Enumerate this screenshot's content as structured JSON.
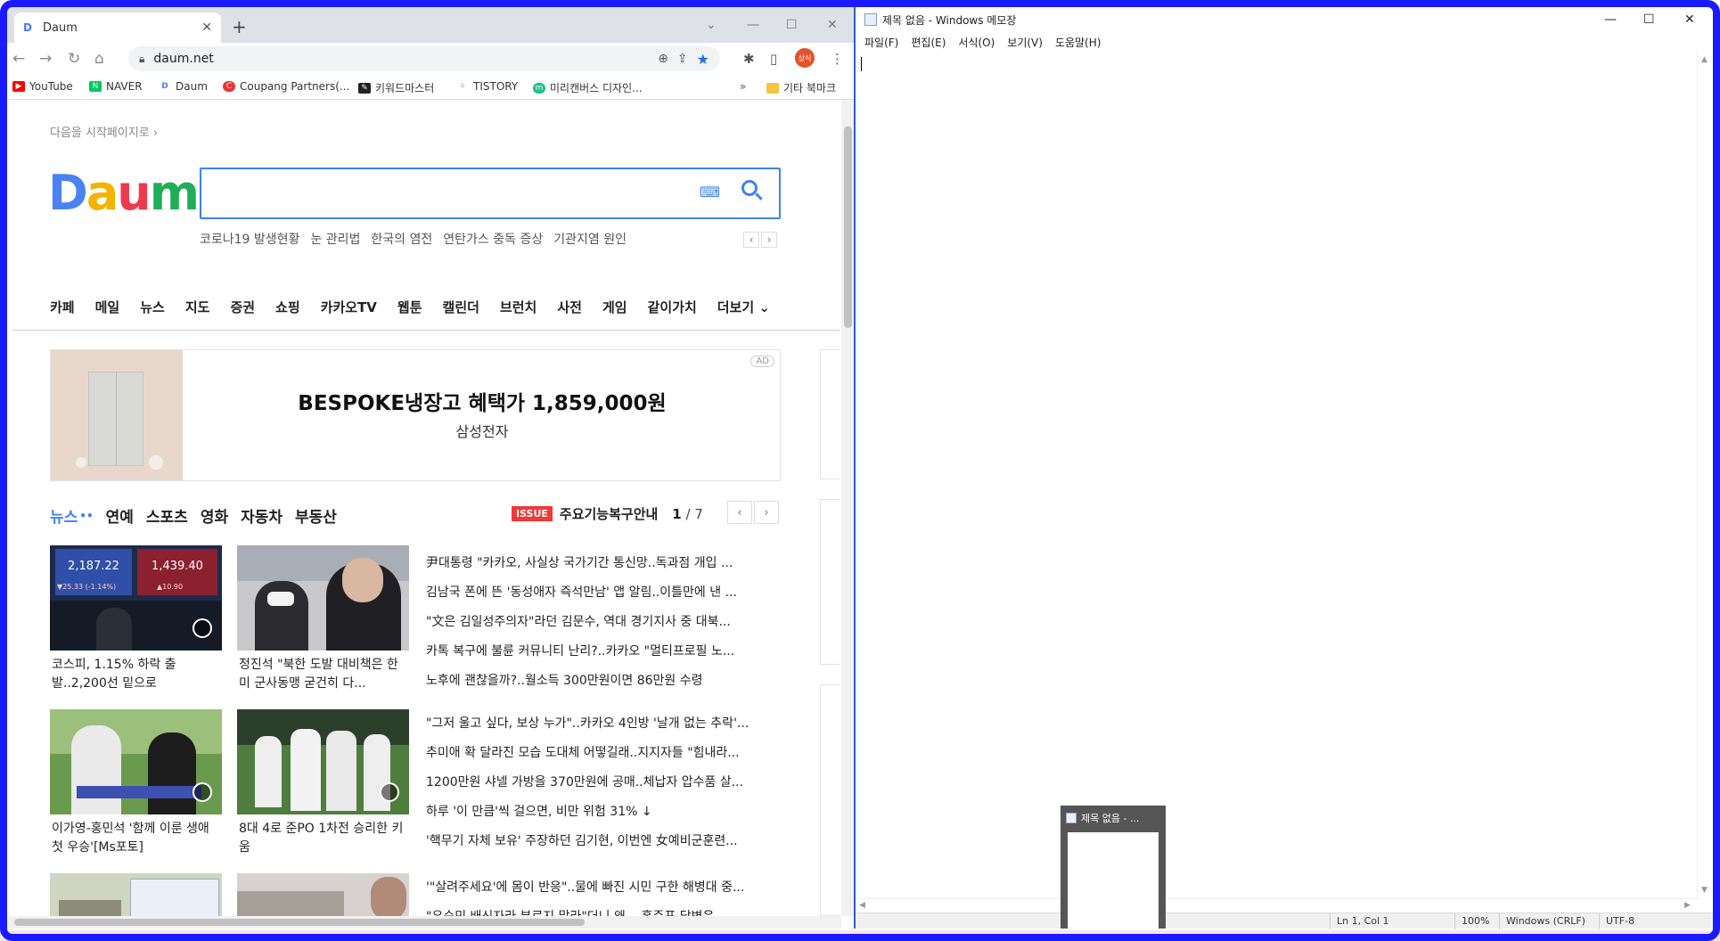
{
  "chrome": {
    "tab_title": "Daum",
    "url": "daum.net",
    "profile_label": "상식",
    "bookmarks": [
      "YouTube",
      "NAVER",
      "Daum",
      "Coupang Partners(...",
      "키워드마스터",
      "TISTORY",
      "미리캔버스 디자인..."
    ],
    "other_bookmarks": "기타 북마크"
  },
  "daum": {
    "start_page_link": "다음을 시작페이지로 ›",
    "logo": [
      "D",
      "a",
      "u",
      "m"
    ],
    "trends": [
      "코로나19 발생현황",
      "눈 관리법",
      "한국의 염전",
      "연탄가스 중독 증상",
      "기관지염 원인"
    ],
    "gnb": [
      "카페",
      "메일",
      "뉴스",
      "지도",
      "증권",
      "쇼핑",
      "카카오TV",
      "웹툰",
      "캘린더",
      "브런치",
      "사전",
      "게임",
      "같이가치",
      "더보기 ⌄"
    ],
    "ad": {
      "title": "BESPOKE냉장고 혜택가 1,859,000원",
      "subtitle": "삼성전자",
      "badge": "AD"
    },
    "news_tabs": [
      "뉴스",
      "연예",
      "스포츠",
      "영화",
      "자동차",
      "부동산"
    ],
    "issue_badge": "ISSUE",
    "issue_text": "주요기능복구안내",
    "issue_page_current": "1",
    "issue_page_total": "/ 7",
    "thumbnails": [
      {
        "caption": "코스피, 1.15% 하락 출발..2,200선 밑으로",
        "screen_a": "2,187.22",
        "screen_b": "1,439.40",
        "screen_c": "▼25.33 (-1.14%)",
        "screen_d": "▲10.90"
      },
      {
        "caption": "정진석 \"북한 도발 대비책은 한미 군사동맹 굳건히 다..."
      },
      {
        "caption": "이가영-홍민석 '함께 이룬 생애 첫 우승'[Ms포토]"
      },
      {
        "caption": "8대 4로 준PO 1차전 승리한 키움"
      }
    ],
    "headlines_1": [
      "尹대통령 \"카카오, 사실상 국가기간 통신망..독과점 개입 ...",
      "김남국 폰에 뜬 '동성애자 즉석만남' 앱 알림..이틀만에 낸 ...",
      "\"文은 김일성주의자\"라던 김문수, 역대 경기지사 중 대북...",
      "카톡 복구에 불륜 커뮤니티 난리?..카카오 \"멀티프로필 노...",
      "노후에 괜찮을까?..월소득 300만원이면 86만원 수령"
    ],
    "headlines_2": [
      "\"그저 울고 싶다, 보상 누가\"..카카오 4인방 '날개 없는 추락'...",
      "추미애 확 달라진 모습 도대체 어떻길래..지지자들 \"힘내라...",
      "1200만원 샤넬 가방을 370만원에 공매..체납자 압수품 살...",
      "하루 '이 만큼'씩 걸으면, 비만 위험 31% ↓",
      "'핵무기 자체 보유' 주장하던 김기현, 이번엔 女예비군훈련..."
    ],
    "headlines_3": [
      "'\"살려주세요'에 몸이 반응\"..물에 빠진 시민 구한 해병대 중...",
      "\"유승민 배신자라 부르지 말라\"더니 왜 .. 홍준표 답변은"
    ]
  },
  "notepad": {
    "title": "제목 없음 - Windows 메모장",
    "menu": [
      "파일(F)",
      "편집(E)",
      "서식(O)",
      "보기(V)",
      "도움말(H)"
    ],
    "status": {
      "position": "Ln 1, Col 1",
      "zoom": "100%",
      "line_ending": "Windows (CRLF)",
      "encoding": "UTF-8"
    }
  },
  "taskbar_preview": {
    "title": "제목 없음 - ..."
  }
}
